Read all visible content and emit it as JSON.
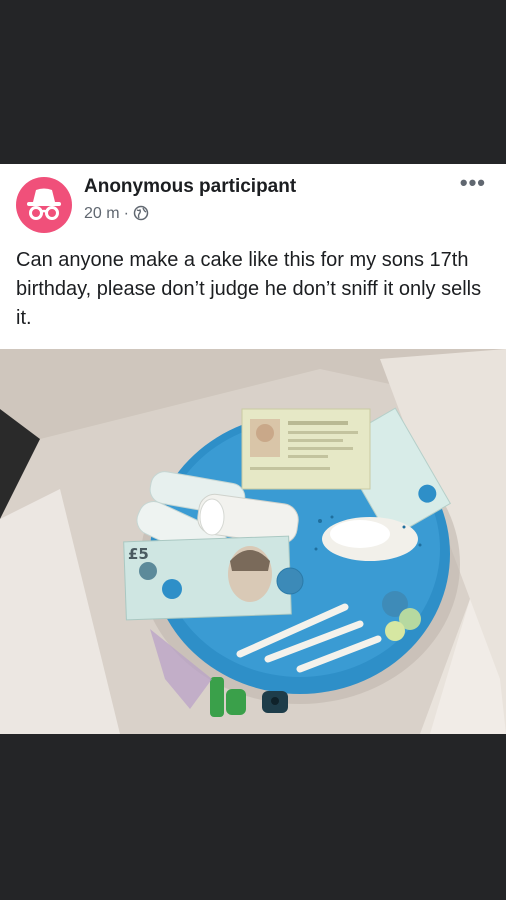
{
  "post": {
    "author": "Anonymous participant",
    "time": "20 m",
    "separator": "·",
    "more_label": "•••",
    "text": "Can anyone make a cake like this for my sons 17th birthday, please don’t judge he don’t sniff it only sells it."
  },
  "photo": {
    "note_label": "£5",
    "note_label_rotated": "£5"
  },
  "icons": {
    "avatar": "incognito-icon",
    "privacy": "globe-icon",
    "menu": "more-options-icon"
  },
  "colors": {
    "dark_background": "#242527",
    "card": "#ffffff",
    "avatar": "#f0507a",
    "cake": "#2e8fc8"
  }
}
